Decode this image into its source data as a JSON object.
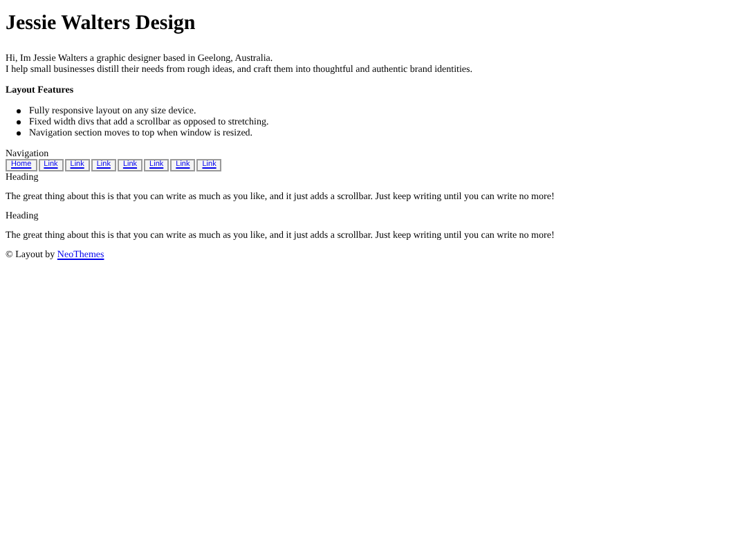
{
  "title": "Jessie Walters Design",
  "intro": [
    "Hi, Im Jessie Walters a graphic designer based in Geelong, Australia.",
    "I help small businesses distill their needs from rough ideas, and craft them into thoughtful and authentic brand identities."
  ],
  "features_heading": "Layout Features",
  "features": [
    "Fully responsive layout on any size device.",
    "Fixed width divs that add a scrollbar as opposed to stretching.",
    "Navigation section moves to top when window is resized."
  ],
  "navigation": {
    "label": "Navigation",
    "links": [
      "Home",
      "Link",
      "Link",
      "Link",
      "Link",
      "Link",
      "Link",
      "Link"
    ]
  },
  "sections": [
    {
      "heading": "Heading",
      "text": "The great thing about this is that you can write as much as you like, and it just adds a scrollbar. Just keep writing until you can write no more!"
    },
    {
      "heading": "Heading",
      "text": "The great thing about this is that you can write as much as you like, and it just adds a scrollbar. Just keep writing until you can write no more!"
    }
  ],
  "footer": {
    "text": "© Layout by",
    "link": "NeoThemes"
  }
}
